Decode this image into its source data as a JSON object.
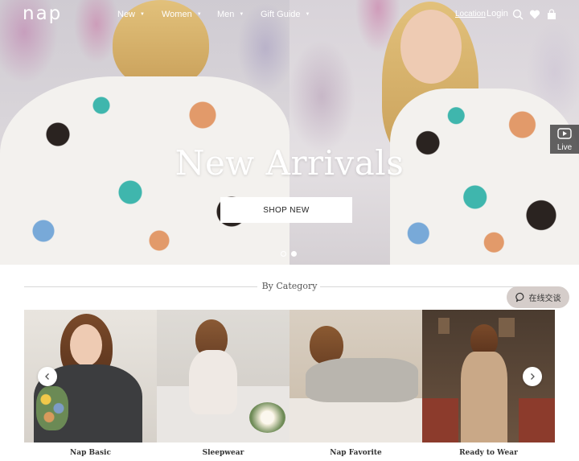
{
  "header": {
    "logo": "nap",
    "nav": [
      {
        "label": "New"
      },
      {
        "label": "Women"
      },
      {
        "label": "Men"
      },
      {
        "label": "Gift Guide"
      }
    ],
    "location": "Location",
    "login": "Login",
    "icons": [
      "search-icon",
      "heart-icon",
      "bag-icon"
    ]
  },
  "hero": {
    "title": "New Arrivals",
    "button": "SHOP NEW",
    "slides_total": 2,
    "active_slide": 2
  },
  "live": {
    "label": "Live",
    "icon": "play-icon"
  },
  "categories": {
    "heading": "By Category",
    "items": [
      {
        "label": "Nap Basic"
      },
      {
        "label": "Sleepwear"
      },
      {
        "label": "Nap Favorite"
      },
      {
        "label": "Ready to Wear"
      }
    ]
  },
  "chat": {
    "label": "在线交谈",
    "icon": "chat-bubble-icon"
  },
  "colors": {
    "accent": "#ffffff",
    "chat_bg": "#d5cdca",
    "divider": "#d8d8d8"
  }
}
